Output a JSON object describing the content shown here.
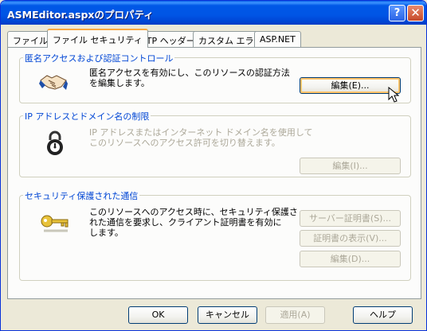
{
  "window": {
    "title": "ASMEditor.aspxのプロパティ",
    "help_glyph": "?",
    "close_glyph": "✕"
  },
  "tabs": [
    {
      "label": "ファイル",
      "active": false
    },
    {
      "label": "ファイル セキュリティ",
      "active": true
    },
    {
      "label": "HTTP ヘッダー",
      "active": false
    },
    {
      "label": "カスタム エラー",
      "active": false
    },
    {
      "label": "ASP.NET",
      "active": false
    }
  ],
  "auth_group": {
    "title": "匿名アクセスおよび認証コントロール",
    "description_line1": "匿名アクセスを有効にし、このリソースの認証方法",
    "description_line2": "を編集します。",
    "edit_button": "編集(E)..."
  },
  "ip_group": {
    "title": "IP アドレスとドメイン名の制限",
    "description_line1": "IP アドレスまたはインターネット ドメイン名を使用して",
    "description_line2": "このリソースへのアクセス許可を切り替えます。",
    "edit_button": "編集(I)..."
  },
  "secure_group": {
    "title": "セキュリティ保護された通信",
    "description_line1": "このリソースへのアクセス時に、セキュリティ保護さ",
    "description_line2": "れた通信を要求し、クライアント証明書を有効に",
    "description_line3": "します。",
    "server_cert_button": "サーバー証明書(S)...",
    "view_cert_button": "証明書の表示(V)...",
    "edit_button": "編集(D)..."
  },
  "footer": {
    "ok": "OK",
    "cancel": "キャンセル",
    "apply": "適用(A)",
    "help": "ヘルプ"
  },
  "colors": {
    "titlebar": "#0058e6",
    "active_tab_accent": "#f9a940",
    "group_title": "#0046d5",
    "disabled_text": "#aca899"
  }
}
